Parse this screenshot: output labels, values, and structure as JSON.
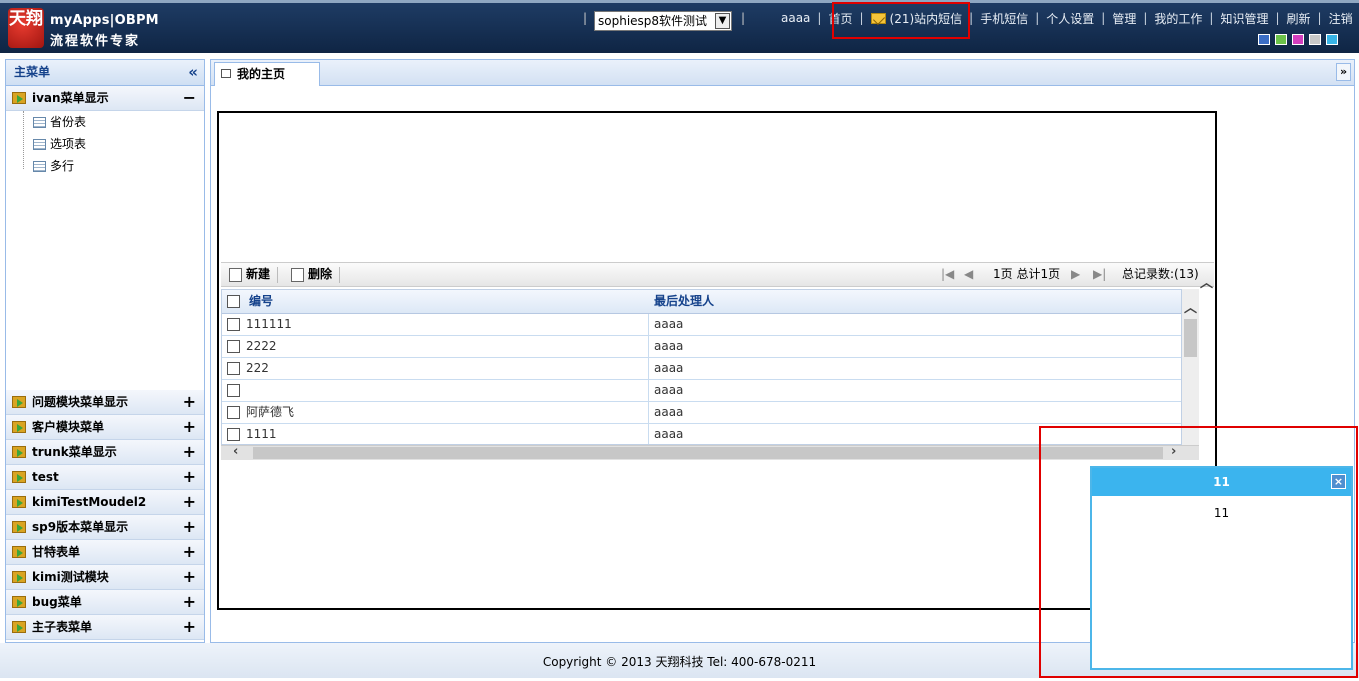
{
  "header": {
    "logo_text": "天翔",
    "brand_line1": "myApps|OBPM",
    "brand_line2": "流程软件专家",
    "domain_select": "sophiesp8软件测试",
    "user": "aaaa",
    "nav": [
      "首页",
      "(21)站内短信",
      "手机短信",
      "个人设置",
      "管理",
      "我的工作",
      "知识管理",
      "刷新",
      "注销"
    ],
    "swatch_colors": [
      "#3b6ec6",
      "#6cc24a",
      "#d43fbf",
      "#c8c8c8",
      "#38b4e6"
    ]
  },
  "sidebar": {
    "title": "主菜单",
    "collapse_icon": "«",
    "open_group": {
      "label": "ivan菜单显示",
      "toggle": "−",
      "items": [
        "省份表",
        "选项表",
        "多行"
      ]
    },
    "groups": [
      "问题模块菜单显示",
      "客户模块菜单",
      "trunk菜单显示",
      "test",
      "kimiTestMoudel2",
      "sp9版本菜单显示",
      "甘特表单",
      "kimi测试模块",
      "bug菜单",
      "主子表菜单"
    ],
    "expand_symbol": "+"
  },
  "main": {
    "tab": "我的主页",
    "tab_menu": "»",
    "toolbar": {
      "new": "新建",
      "delete": "删除",
      "page_text": "1页 总计1页",
      "total": "总记录数:(13)"
    },
    "columns": [
      "编号",
      "最后处理人"
    ],
    "rows": [
      [
        "111111",
        "aaaa"
      ],
      [
        "2222",
        "aaaa"
      ],
      [
        "222",
        "aaaa"
      ],
      [
        "",
        "aaaa"
      ],
      [
        "阿萨德飞",
        "aaaa"
      ],
      [
        "1111",
        "aaaa"
      ]
    ]
  },
  "footer": "Copyright © 2013 天翔科技 Tel: 400-678-0211",
  "popup": {
    "title": "11",
    "body": "11",
    "close": "×"
  }
}
